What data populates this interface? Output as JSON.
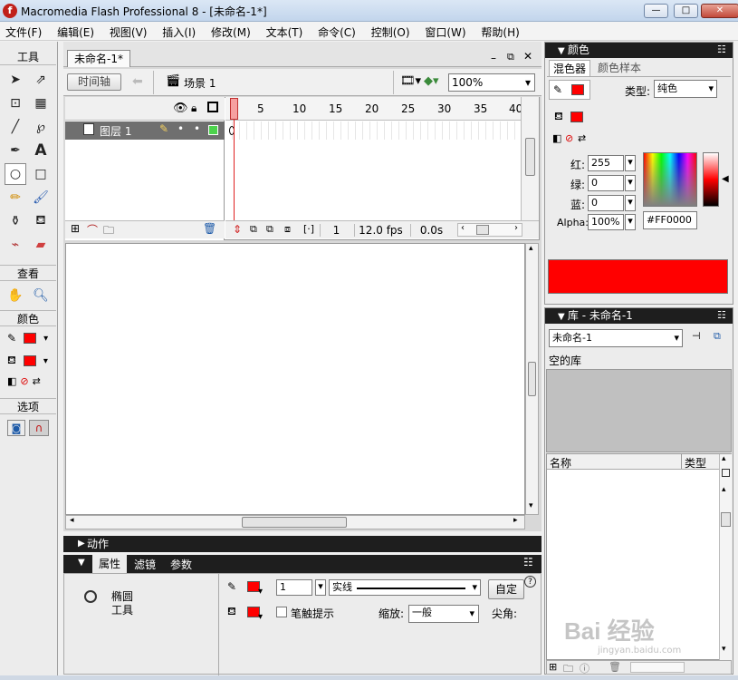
{
  "window": {
    "title": "Macromedia Flash Professional 8 - [未命名-1*]",
    "logo_char": "f",
    "min_label": "—",
    "max_label": "□",
    "close_label": "✕"
  },
  "menu": [
    "文件(F)",
    "编辑(E)",
    "视图(V)",
    "插入(I)",
    "修改(M)",
    "文本(T)",
    "命令(C)",
    "控制(O)",
    "窗口(W)",
    "帮助(H)"
  ],
  "tools": {
    "title": "工具",
    "view_title": "查看",
    "color_title": "颜色",
    "options_title": "选项"
  },
  "document": {
    "tab_label": "未命名-1*",
    "timeline_button": "时间轴",
    "scene_label": "场景 1",
    "zoom_value": "100%"
  },
  "timeline": {
    "ruler_marks": [
      "1",
      "5",
      "10",
      "15",
      "20",
      "25",
      "30",
      "35",
      "40"
    ],
    "layer_name": "图层 1",
    "current_frame": "1",
    "fps": "12.0 fps",
    "elapsed": "0.0s"
  },
  "action_panel": {
    "title": "动作"
  },
  "properties": {
    "tabs": [
      "属性",
      "滤镜",
      "参数"
    ],
    "tool_name": "椭圆",
    "tool_sub": "工具",
    "stroke_width": "1",
    "stroke_style": "实线",
    "custom_button": "自定",
    "hinting_label": "笔触提示",
    "scale_label": "缩放:",
    "scale_value": "一般",
    "cap_label": "尖角:"
  },
  "color_panel": {
    "title": "颜色",
    "tab_mixer": "混色器",
    "tab_swatches": "颜色样本",
    "type_label": "类型:",
    "type_value": "纯色",
    "red_label": "红:",
    "red_value": "255",
    "green_label": "绿:",
    "green_value": "0",
    "blue_label": "蓝:",
    "blue_value": "0",
    "alpha_label": "Alpha:",
    "alpha_value": "100%",
    "hex_value": "#FF0000",
    "current_color": "#FF0000"
  },
  "library_panel": {
    "title": "库 - 未命名-1",
    "doc_select": "未命名-1",
    "empty_label": "空的库",
    "col_name": "名称",
    "col_type": "类型"
  },
  "watermark": {
    "text": "Bai 经验",
    "sub": "jingyan.baidu.com"
  }
}
